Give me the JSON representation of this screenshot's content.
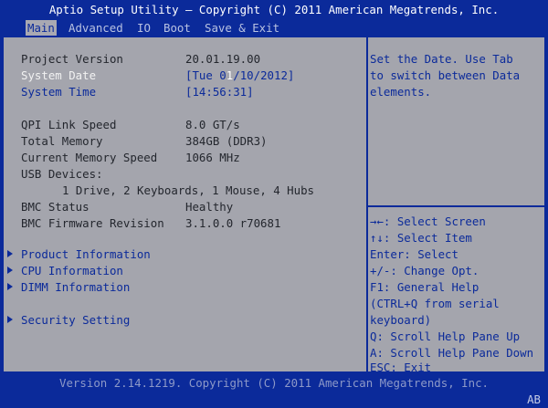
{
  "title": "Aptio Setup Utility – Copyright (C) 2011 American Megatrends, Inc.",
  "tabs": [
    {
      "label": "Main",
      "active": true
    },
    {
      "label": "Advanced"
    },
    {
      "label": "IO"
    },
    {
      "label": "Boot"
    },
    {
      "label": "Save & Exit"
    }
  ],
  "main": {
    "project_version": {
      "label": "Project Version",
      "value": "20.01.19.00"
    },
    "system_date": {
      "label": "System Date",
      "value_prefix": "[Tue 0",
      "value_cursor": "1",
      "value_suffix": "/10/2012]"
    },
    "system_time": {
      "label": "System Time",
      "value": "[14:56:31]"
    },
    "qpi": {
      "label": "QPI Link Speed",
      "value": "8.0 GT/s"
    },
    "total_memory": {
      "label": "Total Memory",
      "value": "384GB (DDR3)"
    },
    "mem_speed": {
      "label": "Current Memory Speed",
      "value": "1066 MHz"
    },
    "usb": {
      "label": "USB Devices:",
      "value": "1 Drive, 2 Keyboards, 1 Mouse, 4 Hubs"
    },
    "bmc_status": {
      "label": "BMC Status",
      "value": "Healthy"
    },
    "bmc_fw": {
      "label": "BMC Firmware Revision",
      "value": "3.1.0.0 r70681"
    },
    "submenus": {
      "product": "Product Information",
      "cpu": "CPU Information",
      "dimm": "DIMM Information",
      "security": "Security Setting"
    }
  },
  "help": {
    "lines": [
      "Set the Date. Use Tab",
      "to switch between Data",
      "elements."
    ]
  },
  "keys": [
    "→←: Select Screen",
    "↑↓: Select Item",
    "Enter: Select",
    "+/-: Change Opt.",
    "F1: General Help",
    "(CTRL+Q from serial",
    "keyboard)",
    "Q: Scroll Help Pane Up",
    "A: Scroll Help Pane Down",
    "ESC: Exit"
  ],
  "footer": "Version 2.14.1219. Copyright (C) 2011 American Megatrends, Inc.",
  "corner": "AB"
}
